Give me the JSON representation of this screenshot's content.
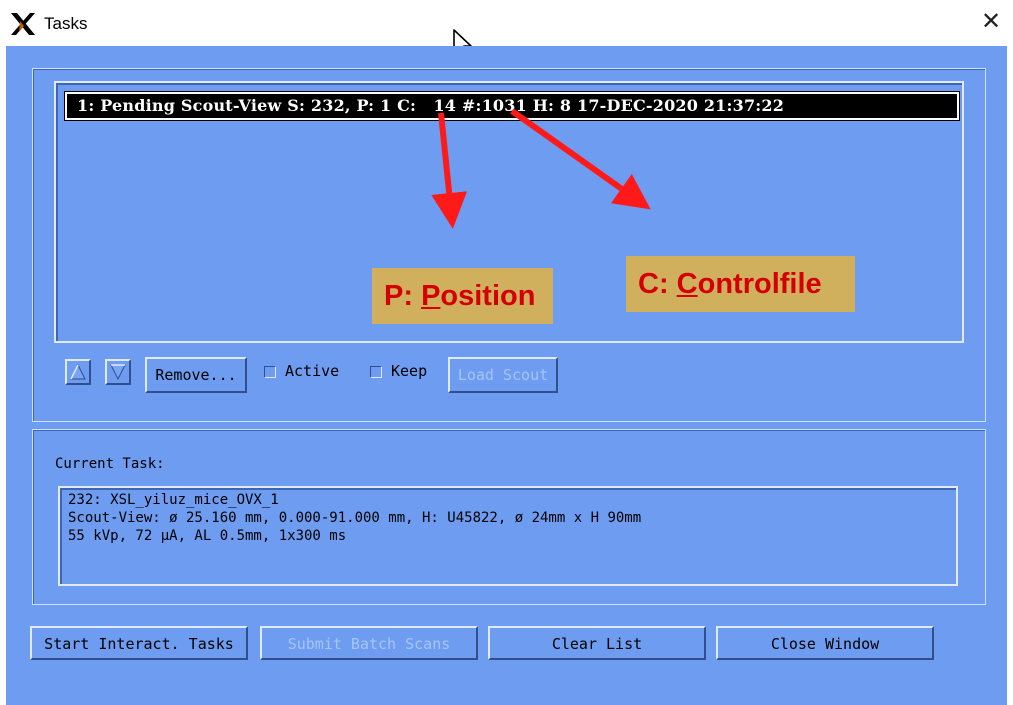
{
  "window": {
    "title": "Tasks",
    "close_glyph": "✕",
    "logo_icon": "x-window-logo-icon"
  },
  "task_list": {
    "items": [
      {
        "text": "1: Pending Scout-View S: 232, P: 1 C:   14 #:1031 H: 8 17-DEC-2020 21:37:22"
      }
    ]
  },
  "annotations": {
    "position": {
      "prefix": "P: ",
      "underlined": "P",
      "rest": "osition"
    },
    "controlfile": {
      "prefix": "C: ",
      "underlined": "C",
      "rest": "ontrolfile"
    },
    "arrow_color": "#ff1a1a",
    "label_bg": "#d1b05d"
  },
  "list_controls": {
    "up_icon": "arrow-up-icon",
    "down_icon": "arrow-down-icon",
    "remove_label": "Remove...",
    "active_label": "Active",
    "keep_label": "Keep",
    "load_scout_label": "Load Scout"
  },
  "current_task": {
    "label": "Current Task:",
    "lines": [
      "232: XSL_yiluz_mice_OVX_1",
      "Scout-View: ø 25.160 mm, 0.000-91.000 mm, H: U45822, ø 24mm x H 90mm",
      "55 kVp, 72 µA, AL 0.5mm, 1x300 ms"
    ]
  },
  "footer_buttons": {
    "start": "Start Interact. Tasks",
    "submit": "Submit Batch Scans",
    "clear": "Clear List",
    "close": "Close Window"
  },
  "colors": {
    "window_bg": "#6e9cf0",
    "selected_row_bg": "#000000"
  }
}
